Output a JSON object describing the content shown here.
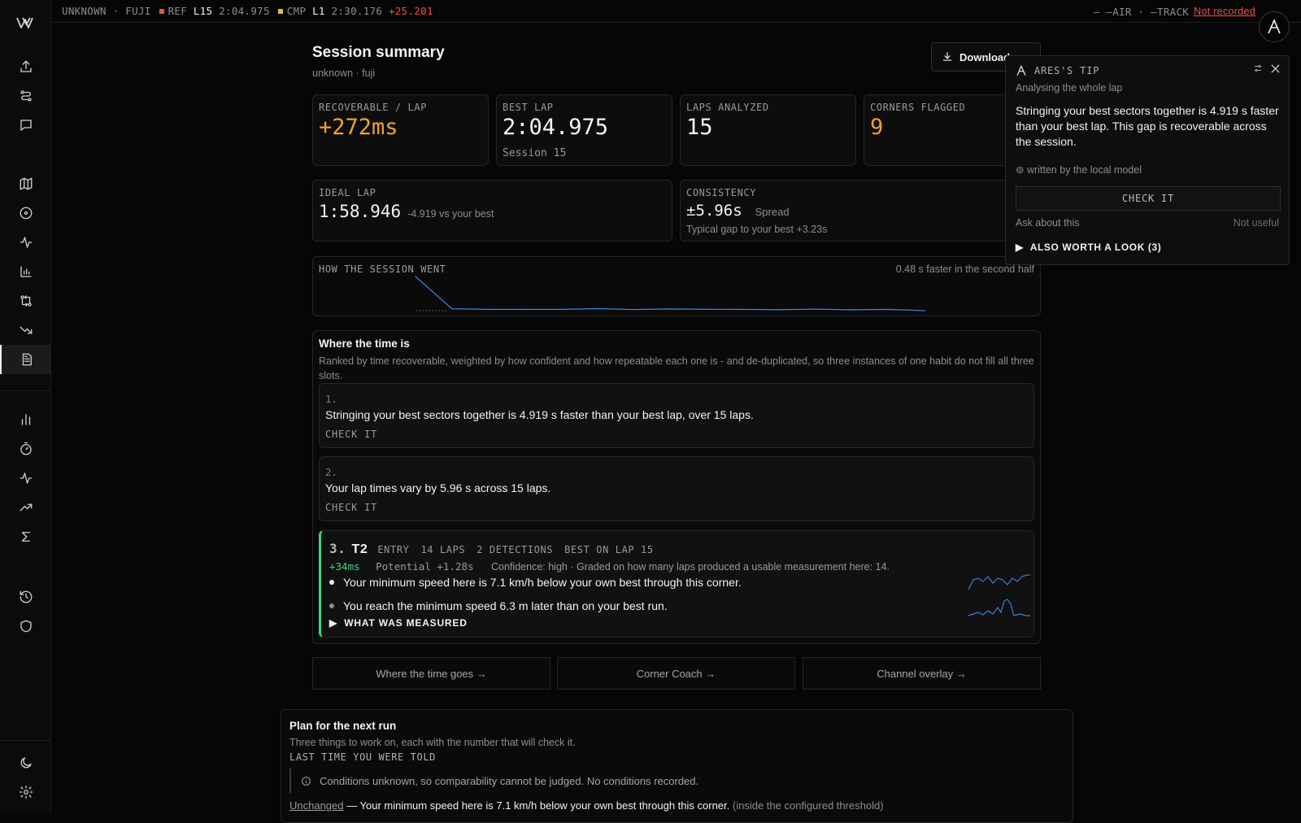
{
  "colors": {
    "accent_orange": "#f0a030",
    "ref_square": "#e05a2a",
    "cmp_square": "#d6c23a",
    "good_green": "#3fd67e",
    "red": "#ef4f4f",
    "line_blue": "#3a7fd0"
  },
  "sidebar": {
    "logo": "w-logo-icon",
    "items": [
      {
        "icon": "upload-icon"
      },
      {
        "icon": "routes-icon"
      },
      {
        "icon": "chat-icon"
      },
      {
        "icon": "map-icon"
      },
      {
        "icon": "target-icon"
      },
      {
        "icon": "activity-icon"
      },
      {
        "icon": "bar-chart-icon"
      },
      {
        "icon": "compare-icon"
      },
      {
        "icon": "trending-down-icon"
      },
      {
        "icon": "report-icon",
        "active": true
      },
      {
        "icon": "stats-icon"
      },
      {
        "icon": "stopwatch-icon"
      },
      {
        "icon": "pulse-icon"
      },
      {
        "icon": "trending-up-icon"
      },
      {
        "icon": "sigma-icon"
      },
      {
        "icon": "history-icon"
      },
      {
        "icon": "shield-icon"
      },
      {
        "icon": "moon-icon"
      },
      {
        "icon": "settings-icon"
      }
    ]
  },
  "topbar": {
    "session": "UNKNOWN · FUJI",
    "ref_label": "REF",
    "ref_lap": "L15",
    "ref_time": "2:04.975",
    "cmp_label": "CMP",
    "cmp_lap": "L1",
    "cmp_time": "2:30.176",
    "delta": "+25.201",
    "air": "— —AIR",
    "sep": "·",
    "track": "—TRACK",
    "status": "Not recorded"
  },
  "header": {
    "title": "Session summary",
    "subtitle": "unknown · fuji",
    "download_label": "Download"
  },
  "stats": {
    "recoverable": {
      "label": "RECOVERABLE / LAP",
      "value": "+272ms"
    },
    "best_lap": {
      "label": "BEST LAP",
      "value": "2:04.975",
      "sub": "Session 15"
    },
    "laps": {
      "label": "LAPS ANALYZED",
      "value": "15"
    },
    "corners": {
      "label": "CORNERS FLAGGED",
      "value": "9"
    },
    "ideal": {
      "label": "IDEAL LAP",
      "value": "1:58.946",
      "delta": "-4.919 vs your best"
    },
    "consistency": {
      "label": "CONSISTENCY",
      "value": "±5.96s",
      "spread": "Spread",
      "sub": "Typical gap to your best +3.23s"
    }
  },
  "session_chart": {
    "label": "HOW THE SESSION WENT",
    "note": "0.48 s faster in the second half"
  },
  "chart_data": {
    "type": "line",
    "x": [
      1,
      2,
      3,
      4,
      5,
      6,
      7,
      8,
      9,
      10,
      11,
      12,
      13,
      14,
      15
    ],
    "y": [
      150.176,
      126.4,
      125.9,
      125.9,
      125.9,
      126.5,
      125.8,
      126.2,
      126.0,
      125.9,
      125.7,
      126.1,
      125.6,
      125.9,
      124.975
    ]
  },
  "where": {
    "title": "Where the time is",
    "desc": "Ranked by time recoverable, weighted by how confident and how repeatable each one is - and de-duplicated, so three instances of one habit do not fill all three slots.",
    "items": [
      {
        "num": "1.",
        "text": "Stringing your best sectors together is 4.919 s faster than your best lap, over 15 laps.",
        "check": "CHECK IT"
      },
      {
        "num": "2.",
        "text": "Your lap times vary by 5.96 s across 15 laps.",
        "check": "CHECK IT"
      }
    ],
    "corner": {
      "num": "3.",
      "name": "T2",
      "phase": "ENTRY",
      "laps": "14 LAPS",
      "detections": "2 DETECTIONS",
      "best": "BEST ON LAP 15",
      "gain": "+34ms",
      "potential": "Potential +1.28s",
      "confidence": "Confidence: high · Graded on how many laps produced a usable measurement here: 14.",
      "bullet1": "Your minimum speed here is 7.1 km/h below your own best through this corner.",
      "bullet2": "You reach the minimum speed 6.3 m later than on your best run.",
      "measured": "WHAT WAS MEASURED"
    }
  },
  "links": {
    "time_goes": "Where the time goes →",
    "corner_coach": "Corner Coach →",
    "channel_overlay": "Channel overlay →"
  },
  "plan": {
    "title": "Plan for the next run",
    "desc": "Three things to work on, each with the number that will check it.",
    "last_time": "LAST TIME YOU WERE TOLD",
    "note": "Conditions unknown, so comparability cannot be judged. No conditions recorded.",
    "unchanged": "Unchanged",
    "unchanged_text": "— Your minimum speed here is 7.1 km/h below your own best through this corner.",
    "unchanged_note": "(inside the configured threshold)"
  },
  "tip": {
    "title": "ARES'S TIP",
    "analysing": "Analysing the whole lap",
    "body": "Stringing your best sectors together is 4.919 s faster than your best lap. This gap is recoverable across the session.",
    "written": "⊚ written by the local model",
    "check": "CHECK IT",
    "ask": "Ask about this",
    "not_useful": "Not useful",
    "also": "ALSO WORTH A LOOK (3)"
  }
}
